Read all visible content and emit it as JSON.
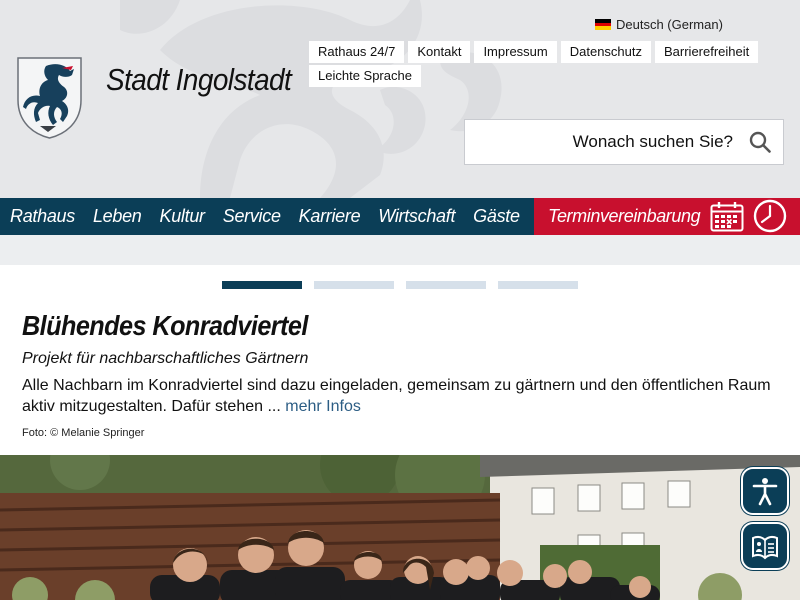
{
  "language": {
    "label": "Deutsch (German)",
    "flag_colors": [
      "#000000",
      "#dd0000",
      "#ffce00"
    ]
  },
  "top_links": [
    {
      "id": "rathaus247",
      "label": "Rathaus 24/7"
    },
    {
      "id": "kontakt",
      "label": "Kontakt"
    },
    {
      "id": "impressum",
      "label": "Impressum"
    },
    {
      "id": "datenschutz",
      "label": "Datenschutz"
    },
    {
      "id": "barrierefreiheit",
      "label": "Barrierefreiheit"
    },
    {
      "id": "leichte-sprache",
      "label": "Leichte Sprache"
    }
  ],
  "site": {
    "title": "Stadt Ingolstadt",
    "logo": "ingolstadt-panther-crest"
  },
  "search": {
    "placeholder": "Wonach suchen Sie?",
    "icon": "magnifier"
  },
  "nav": {
    "items": [
      {
        "id": "rathaus",
        "label": "Rathaus"
      },
      {
        "id": "leben",
        "label": "Leben"
      },
      {
        "id": "kultur",
        "label": "Kultur"
      },
      {
        "id": "service",
        "label": "Service"
      },
      {
        "id": "karriere",
        "label": "Karriere"
      },
      {
        "id": "wirtschaft",
        "label": "Wirtschaft"
      },
      {
        "id": "gaeste",
        "label": "Gäste"
      }
    ],
    "appointment": {
      "label": "Terminvereinbarung",
      "icons": [
        "calendar",
        "clock"
      ]
    }
  },
  "slider": {
    "slide_count": 4,
    "active_index": 0
  },
  "teaser": {
    "title": "Blühendes Konradviertel",
    "subtitle": "Projekt für nachbarschaftliches Gärtnern",
    "text": "Alle Nachbarn im Konradviertel sind dazu eingeladen, gemeinsam zu gärtnern und den öffentlichen Raum aktiv mitzugestalten. Dafür stehen ...",
    "more_label": "mehr Infos",
    "credit": "Foto: © Melanie Springer"
  },
  "accessibility_buttons": [
    "accessibility-person",
    "easy-language-book"
  ],
  "colors": {
    "nav_blue": "#0b3e57",
    "appointment_red": "#c8102e",
    "header_gray": "#e6e7e9",
    "link_blue": "#2c5d84"
  }
}
